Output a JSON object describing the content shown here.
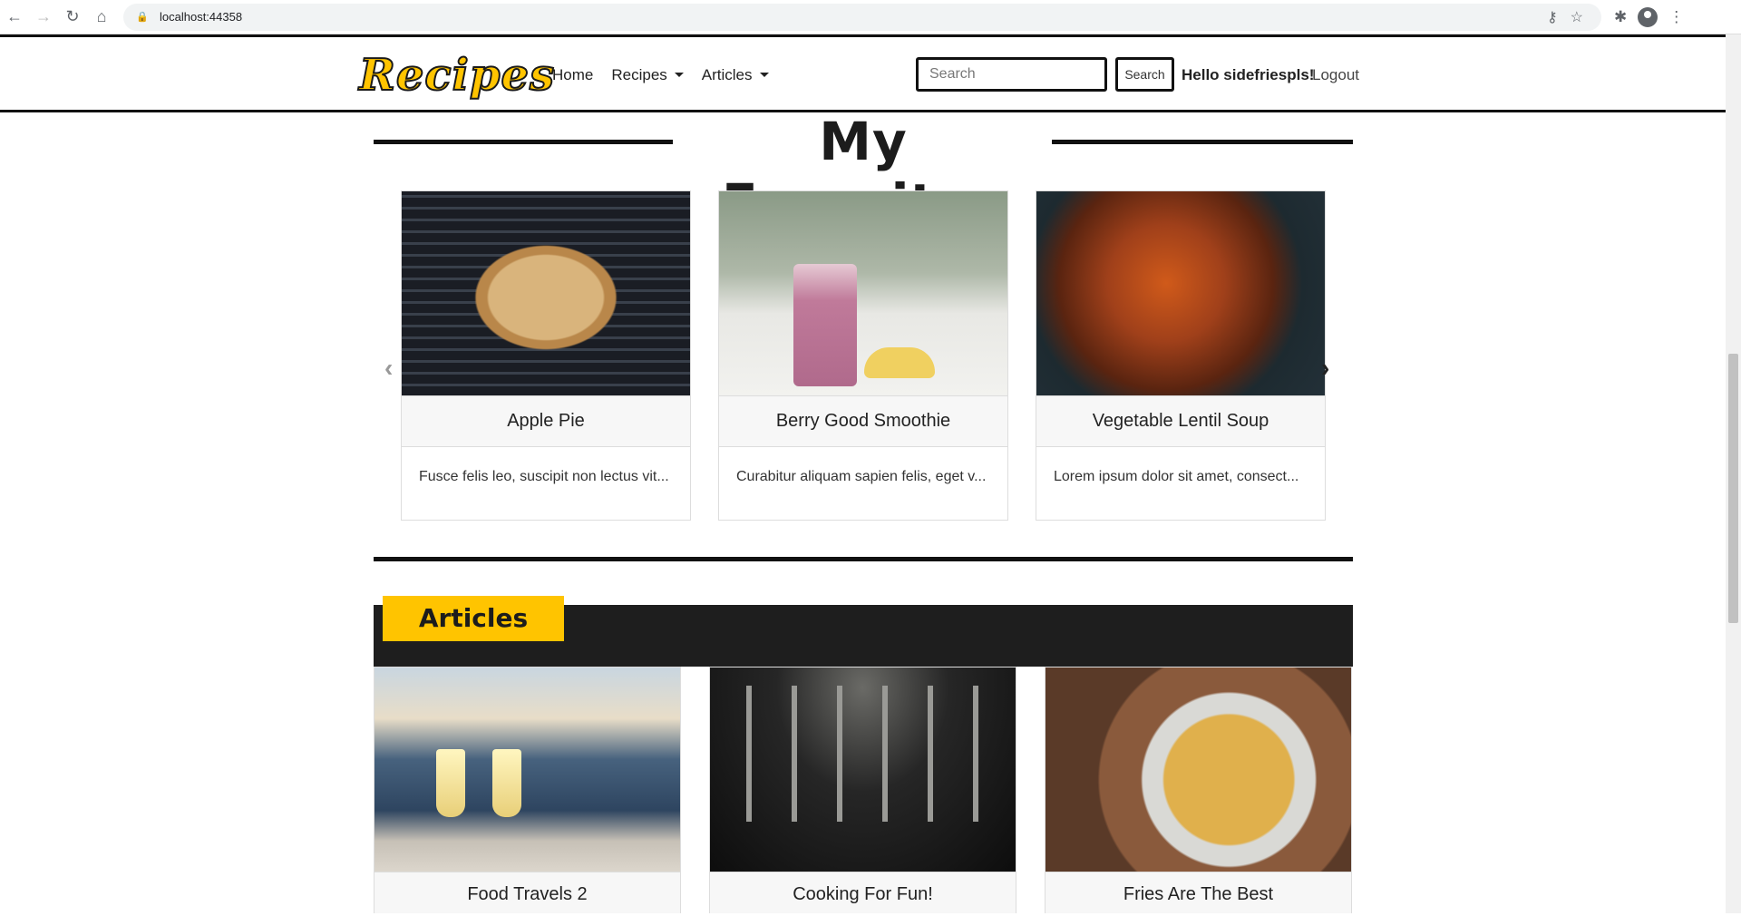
{
  "browser": {
    "url": "localhost:44358"
  },
  "header": {
    "logo": "Recipes",
    "nav": {
      "home": "Home",
      "recipes": "Recipes",
      "articles": "Articles"
    },
    "search_placeholder": "Search",
    "search_button": "Search",
    "greeting": "Hello sidefriespls!",
    "logout": "Logout"
  },
  "favorites": {
    "heading": "My Favorites",
    "prev_arrow": "‹",
    "next_arrow": "›",
    "cards": [
      {
        "title": "Apple Pie",
        "description": "Fusce felis leo, suscipit non lectus vit..."
      },
      {
        "title": "Berry Good Smoothie",
        "description": "Curabitur aliquam sapien felis, eget v..."
      },
      {
        "title": "Vegetable Lentil Soup",
        "description": "Lorem ipsum dolor sit amet, consect..."
      }
    ]
  },
  "articles": {
    "heading": "Articles",
    "cards": [
      {
        "title": "Food Travels 2"
      },
      {
        "title": "Cooking For Fun!"
      },
      {
        "title": "Fries Are The Best"
      }
    ]
  },
  "colors": {
    "accent_yellow": "#ffc400",
    "dark": "#1e1e1e"
  }
}
